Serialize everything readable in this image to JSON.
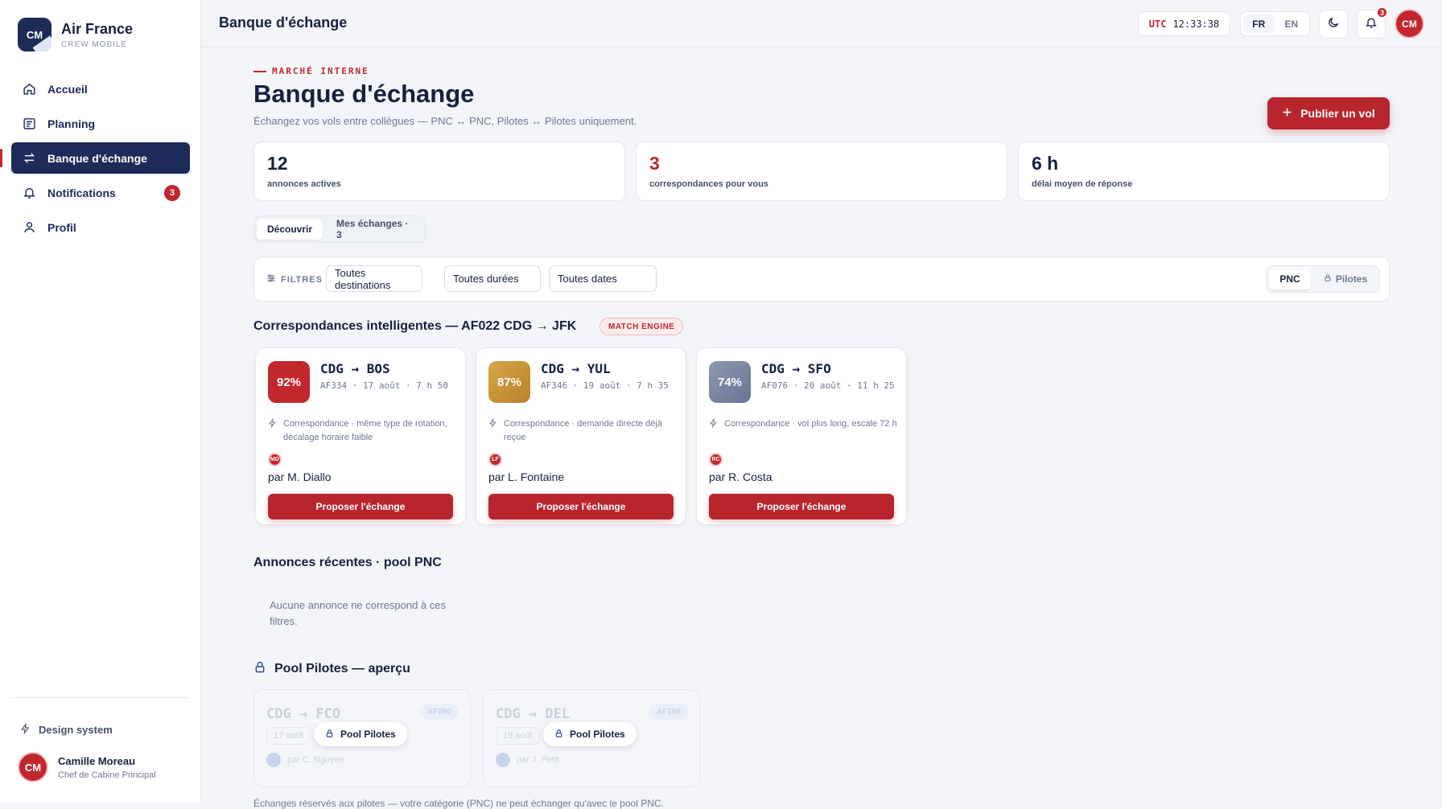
{
  "sidebar": {
    "brand": {
      "logo": "CM",
      "name": "Air France",
      "sub": "CREW MOBILE"
    },
    "items": [
      {
        "label": "Accueil",
        "icon": "home-icon"
      },
      {
        "label": "Planning",
        "icon": "calendar-icon"
      },
      {
        "label": "Banque d'échange",
        "icon": "swap-icon",
        "active": true
      },
      {
        "label": "Notifications",
        "icon": "bell-icon",
        "badge": "3"
      },
      {
        "label": "Profil",
        "icon": "user-icon"
      }
    ],
    "design_system": "Design system",
    "user": {
      "initials": "CM",
      "name": "Camille Moreau",
      "role": "Chef de Cabine Principal"
    }
  },
  "topbar": {
    "title": "Banque d'échange",
    "clock": {
      "zone": "UTC",
      "time": "12:33:38"
    },
    "languages": [
      "FR",
      "EN"
    ],
    "active_language": "FR",
    "notif_count": "3",
    "avatar": "CM"
  },
  "header": {
    "kicker": "MARCHÉ INTERNE",
    "title": "Banque d'échange",
    "subtitle": "Échangez vos vols entre collègues — PNC ↔ PNC, Pilotes ↔ Pilotes uniquement.",
    "publish_label": "Publier un vol"
  },
  "stats": [
    {
      "value": "12",
      "label": "annonces actives"
    },
    {
      "value": "3",
      "label": "correspondances pour vous",
      "accent": true
    },
    {
      "value": "6 h",
      "label": "délai moyen de réponse"
    }
  ],
  "tabs": [
    {
      "label": "Découvrir",
      "active": true
    },
    {
      "label": "Mes échanges · 3"
    }
  ],
  "filters": {
    "label": "FILTRES",
    "selects": [
      "Toutes destinations",
      "Toutes durées",
      "Toutes dates"
    ],
    "pool": [
      "PNC",
      "Pilotes"
    ]
  },
  "matches": {
    "title": "Correspondances intelligentes — AF022 CDG → JFK",
    "tag": "MATCH ENGINE",
    "cards": [
      {
        "pct": "92%",
        "color": "#c1272d",
        "route": "CDG → BOS",
        "meta": "AF334 · 17 août · 7 h 50",
        "reason": "Correspondance · même type de rotation, décalage horaire faible",
        "initials": "MD",
        "by": "par M. Diallo",
        "action": "Proposer l'échange"
      },
      {
        "pct": "87%",
        "color": "#c9922f",
        "route": "CDG → YUL",
        "meta": "AF346 · 19 août · 7 h 35",
        "reason": "Correspondance · demande directe déjà reçue",
        "initials": "LF",
        "by": "par L. Fontaine",
        "action": "Proposer l'échange"
      },
      {
        "pct": "74%",
        "color": "#7a86a3",
        "route": "CDG → SFO",
        "meta": "AF076 · 20 août · 11 h 25",
        "reason": "Correspondance · vol plus long, escale 72 h",
        "initials": "RC",
        "by": "par R. Costa",
        "action": "Proposer l'échange"
      }
    ]
  },
  "recent": {
    "title": "Annonces récentes · pool PNC",
    "empty": "Aucune annonce ne correspond à ces filtres."
  },
  "pilots": {
    "title": "Pool Pilotes — aperçu",
    "cards": [
      {
        "route": "CDG → FCO",
        "tag": "AF090",
        "date": "17 août",
        "by": "par C. Nguyen",
        "lock": "Pool Pilotes"
      },
      {
        "route": "CDG → DEL",
        "tag": "AF166",
        "date": "19 août",
        "by": "par J. Petit",
        "lock": "Pool Pilotes"
      }
    ],
    "footnote": "Échanges réservés aux pilotes — votre catégorie (PNC) ne peut échanger qu'avec le pool PNC."
  }
}
